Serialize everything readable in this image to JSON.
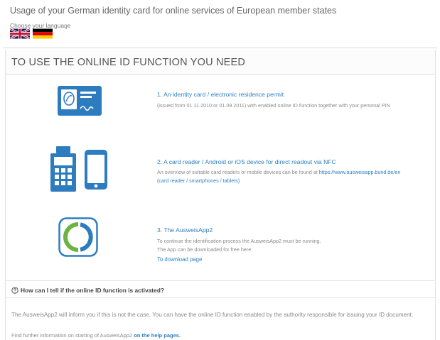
{
  "page": {
    "title": "Usage of your German identity card for online services of European member states",
    "language_label": "Choose your language",
    "languages": [
      {
        "name": "English",
        "icon": "uk-flag-icon"
      },
      {
        "name": "Deutsch",
        "icon": "german-flag-icon"
      }
    ]
  },
  "card": {
    "title": "TO USE THE ONLINE ID FUNCTION YOU NEED",
    "requirements": [
      {
        "icon": "id-card-icon",
        "title": "1. An identity card / electronic residence permit",
        "desc": "(issued from 01.11.2010 or 01.09.2011) with enabled online ID function together with your personal PIN"
      },
      {
        "icon": "card-reader-smartphone-icon",
        "title": "2. A card reader / Android or iOS device for direct readout via NFC",
        "desc_prefix": "An overview of suitable card readers or mobile devices can be found at ",
        "desc_link": "https://www.ausweisapp.bund.de/en",
        "desc_link2": "(card reader / smartphones / tablets)"
      },
      {
        "icon": "ausweisapp-icon",
        "title": "3. The AusweisApp2",
        "desc_line1": "To continue the identification process the AusweisApp2 must be running.",
        "desc_line2": "The App can be downloaded for free here:",
        "link": "To download page"
      }
    ]
  },
  "faq": {
    "icon": "question-circle-icon",
    "question": "How can I tell if the online ID function is activated?",
    "answer": "The AusweisApp2 will inform you if this is not the case. You can have the online ID function enabled by the authority responsible for issuing your ID document.",
    "more_prefix": "Find further information on starting of AusweisApp2 ",
    "more_link": "on the help pages."
  },
  "colors": {
    "accent_blue": "#2f7fc1",
    "icon_blue": "#2e7cc0",
    "green": "#6cb33f"
  }
}
